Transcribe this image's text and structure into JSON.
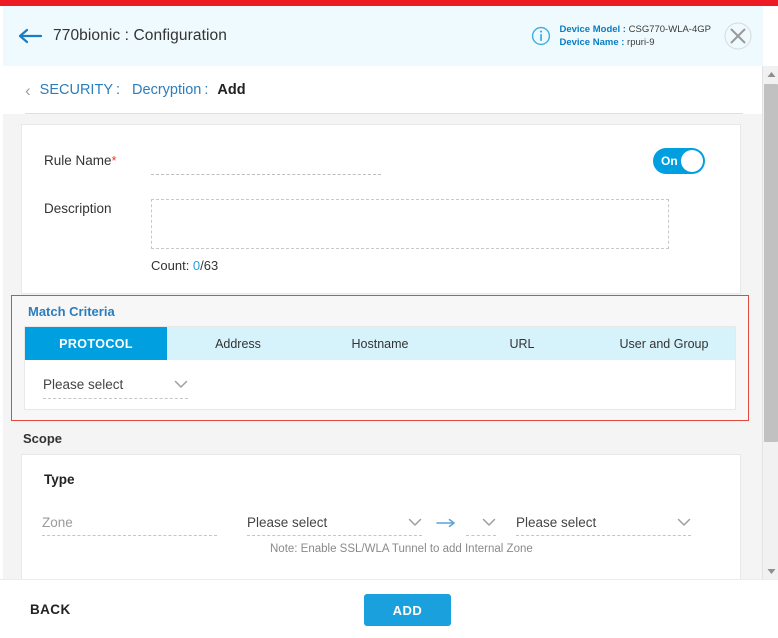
{
  "header": {
    "title": "770bionic : Configuration",
    "back_icon": "arrow-left-icon",
    "info_icon": "info-circle-icon",
    "close_icon": "close-x-icon",
    "device_model_label": "Device Model :",
    "device_model_value": "CSG770-WLA-4GP",
    "device_name_label": "Device Name :",
    "device_name_value": "rpuri-9"
  },
  "breadcrumb": {
    "chevron": "‹",
    "root": "SECURITY",
    "separator": ":",
    "section": "Decryption",
    "current": "Add"
  },
  "general": {
    "rule_name_label": "Rule Name",
    "rule_name_required": "*",
    "rule_name_value": "",
    "rule_name_placeholder": "",
    "description_label": "Description",
    "description_value": "",
    "description_placeholder": "",
    "count_label": "Count: ",
    "count_current": "0",
    "count_max": "/63",
    "enable_toggle_label": "On"
  },
  "match_criteria": {
    "title": "Match Criteria",
    "tabs": [
      {
        "label": "PROTOCOL",
        "active": true
      },
      {
        "label": "Address",
        "active": false
      },
      {
        "label": "Hostname",
        "active": false
      },
      {
        "label": "URL",
        "active": false
      },
      {
        "label": "User and Group",
        "active": false
      }
    ],
    "protocol_select": "Please select"
  },
  "scope": {
    "title": "Scope",
    "type_label": "Type",
    "zone_placeholder": "Zone",
    "source_select": "Please select",
    "direction_arrow": "→",
    "direction_select": "",
    "destination_select": "Please select",
    "note": "Note: Enable SSL/WLA Tunnel to add Internal Zone"
  },
  "footer": {
    "back_label": "BACK",
    "add_label": "ADD"
  },
  "scrollbar": {
    "up_arrow": "▲",
    "down_arrow": "▼"
  },
  "colors": {
    "brand_red": "#ed1c24",
    "accent_blue": "#009fdf",
    "header_bg": "#eefafd",
    "tab_bg": "#d6f3fc",
    "error_border": "#e04a3f",
    "link_blue": "#2c7dbb"
  }
}
